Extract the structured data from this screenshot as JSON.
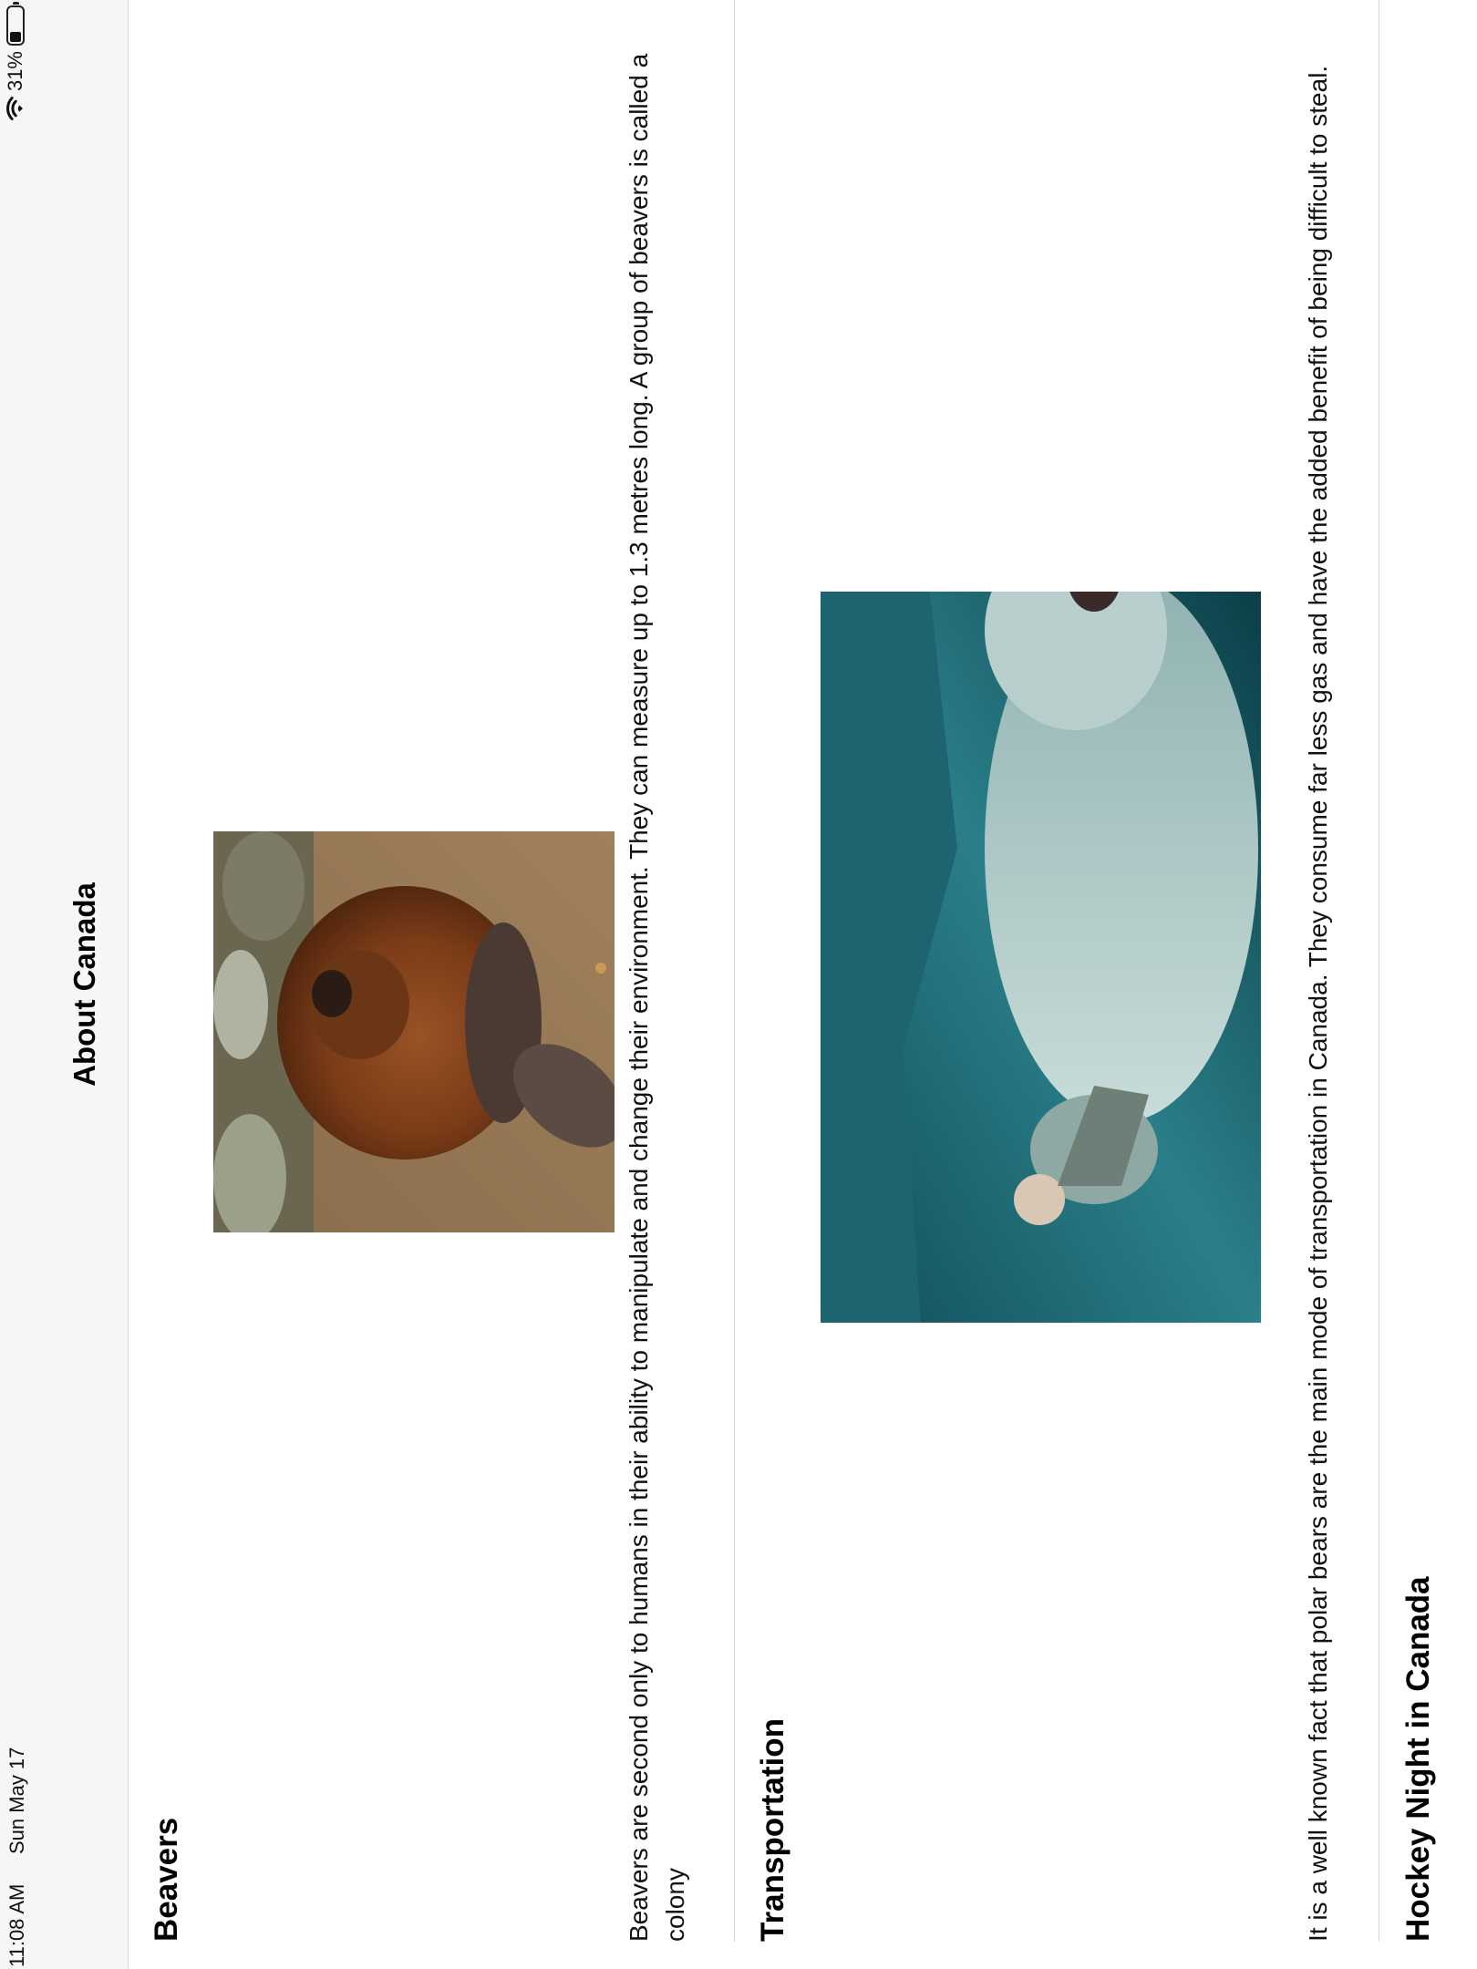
{
  "status_bar": {
    "time": "11:08 AM",
    "date": "Sun May 17",
    "battery": "31%",
    "battery_level": 0.31,
    "icons": [
      "wifi-icon",
      "battery-icon"
    ]
  },
  "nav": {
    "title": "About Canada"
  },
  "sections": [
    {
      "heading": "Beavers",
      "text": "Beavers are second only to humans in their ability to manipulate and change their environment. They can measure up to 1.3 metres long. A group of beavers is called a colony",
      "image": "beaver-photo"
    },
    {
      "heading": "Transportation",
      "text": "It is a well known fact that polar bears are the main mode of transportation in Canada. They consume far less gas and have the added benefit of being difficult to steal.",
      "image": "polar-bear-rider-photo"
    },
    {
      "heading": "Hockey Night in Canada",
      "text": "",
      "image": ""
    }
  ]
}
